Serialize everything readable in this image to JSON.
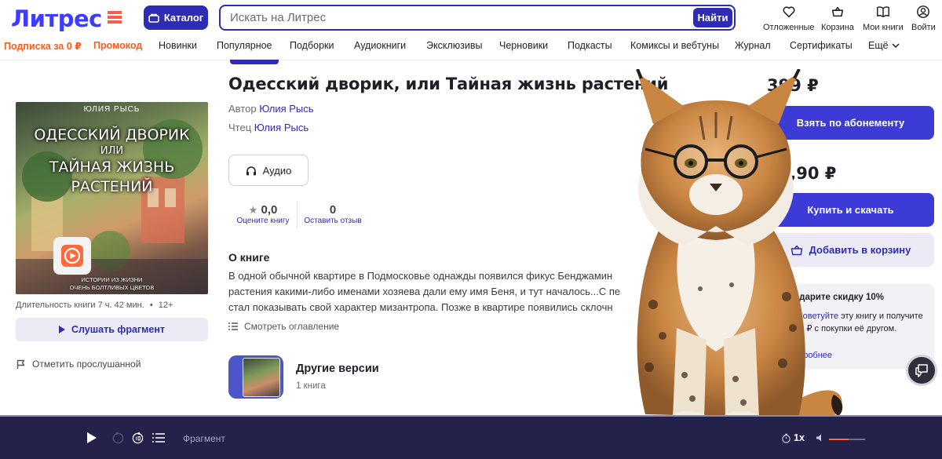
{
  "header": {
    "logo": "Литрес",
    "catalog_label": "Каталог",
    "search": {
      "placeholder": "Искать на Литрес",
      "button": "Найти"
    },
    "actions": [
      {
        "label": "Отложенные",
        "icon": "heart-icon"
      },
      {
        "label": "Корзина",
        "icon": "basket-icon"
      },
      {
        "label": "Мои книги",
        "icon": "book-icon"
      },
      {
        "label": "Войти",
        "icon": "user-icon"
      }
    ]
  },
  "nav": {
    "promo_items": [
      "Подписка за 0 ₽",
      "Промокод"
    ],
    "items": [
      "Новинки",
      "Популярное",
      "Подборки",
      "Аудиокниги",
      "Эксклюзивы",
      "Черновики",
      "Подкасты",
      "Комиксы и вебтуны",
      "Журнал",
      "Сертификаты"
    ],
    "more": "Ещё"
  },
  "cover": {
    "author": "ЮЛИЯ РЫСЬ",
    "title_lines": [
      "ОДЕССКИЙ ДВОРИК",
      "ИЛИ",
      "ТАЙНАЯ ЖИЗНЬ",
      "РАСТЕНИЙ"
    ],
    "subtitle_lines": [
      "ИСТОРИИ ИЗ ЖИЗНИ",
      "ОЧЕНЬ БОЛТЛИВЫХ ЦВЕТОВ"
    ]
  },
  "book": {
    "duration": "Длительность книги 7 ч. 42 мин.",
    "age": "12+",
    "listen_fragment": "Слушать фрагмент",
    "mark_listened": "Отметить прослушанной",
    "title": "Одесский дворик, или Тайная жизнь растений",
    "author_label": "Автор",
    "author": "Юлия Рысь",
    "reader_label": "Чтец",
    "reader": "Юлия Рысь",
    "format": "Аудио",
    "rating": {
      "value": "0,0",
      "caption": "Оцените книгу"
    },
    "reviews": {
      "value": "0",
      "caption": "Оставить отзыв"
    },
    "about_heading": "О книге",
    "about_text": "В одной обычной квартире в Подмосковье однажды появился фикус Бенджамин растения какими-либо именами хозяева дали ему имя Беня, и тут началось...С пе стал показывать свой характер мизантропа. Позже в квартире появились склочн",
    "toc": "Смотреть оглавление",
    "other_versions": {
      "heading": "Другие версии",
      "count": "1 книга"
    }
  },
  "sidebar": {
    "subscription_price": "399 ₽",
    "subscription_button": "Взять по абонементу",
    "buy_price": "49,90 ₽",
    "buy_button": "Купить и скачать",
    "cart_button": "Добавить в корзину",
    "gift": {
      "heading": "Подарите скидку 10%",
      "link": "Посоветуйте",
      "text": " эту книгу и получите 5,00 ₽ с покупки её другом.",
      "more": "Подробнее"
    }
  },
  "player": {
    "label": "Фрагмент",
    "speed": "1x",
    "volume": 0.55
  },
  "colors": {
    "brand": "#2e2bb5",
    "accent": "#ff5c1a",
    "player_bg": "#24224a"
  }
}
